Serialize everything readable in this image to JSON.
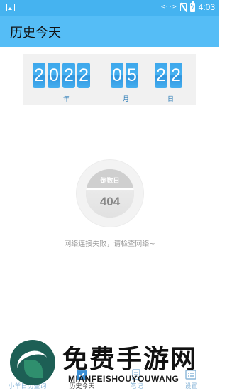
{
  "status_bar": {
    "left_icon": "image-icon",
    "code_text": "<··>",
    "time": "4:03"
  },
  "app_bar": {
    "title": "历史今天"
  },
  "date_panel": {
    "year_digits": [
      "2",
      "0",
      "2",
      "2"
    ],
    "month_digits": [
      "0",
      "5"
    ],
    "day_digits": [
      "2",
      "2"
    ],
    "year_label": "年",
    "month_label": "月",
    "day_label": "日",
    "digit_color": "#45aff0"
  },
  "countdown": {
    "label": "倒数日",
    "value": "404"
  },
  "message": "网络连接失败，请检查网络~",
  "bottom_nav": {
    "items": [
      {
        "label": "小羊日历查询",
        "icon": "calendar-icon",
        "active": false
      },
      {
        "label": "历史今天",
        "icon": "checkbox-icon",
        "active": true
      },
      {
        "label": "笔记",
        "icon": "document-icon",
        "active": false
      },
      {
        "label": "设置",
        "icon": "grid-icon",
        "active": false
      }
    ]
  },
  "watermark": {
    "title": "免费手游网",
    "subtitle": "MIANFEISHOUYOUWANG"
  },
  "colors": {
    "status_bar": "#45b3f0",
    "app_bar": "#55bdf6",
    "accent": "#2a7bb6"
  }
}
